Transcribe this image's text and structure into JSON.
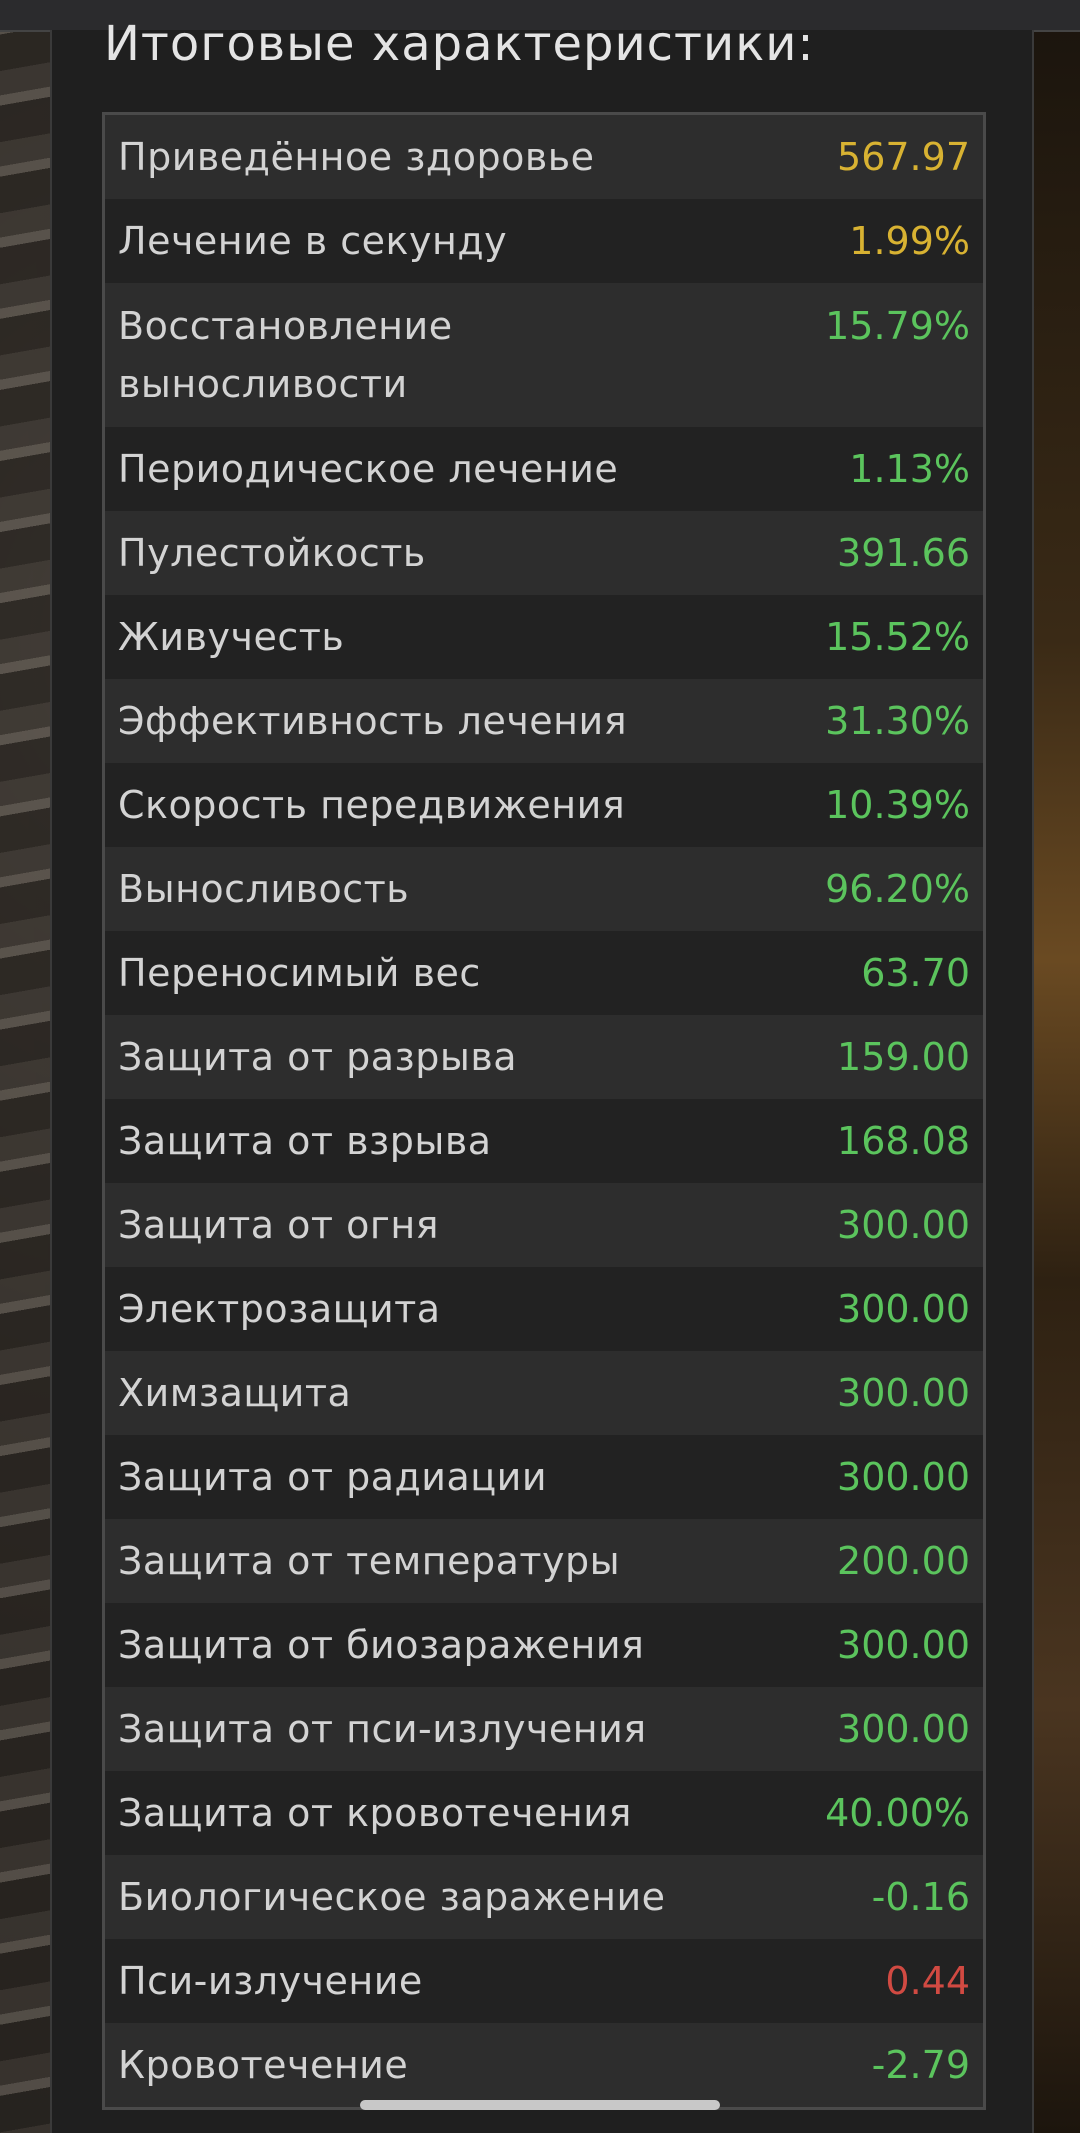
{
  "section": {
    "title": "Итоговые характеристики:"
  },
  "stats": [
    {
      "label": "Приведённое здоровье",
      "value": "567.97",
      "color": "#d8b232"
    },
    {
      "label": "Лечение в секунду",
      "value": "1.99%",
      "color": "#d8b232"
    },
    {
      "label": "Восстановление выносливости",
      "value": "15.79%",
      "color": "#5bc45d"
    },
    {
      "label": "Периодическое лечение",
      "value": "1.13%",
      "color": "#5bc45d"
    },
    {
      "label": "Пулестойкость",
      "value": "391.66",
      "color": "#5bc45d"
    },
    {
      "label": "Живучесть",
      "value": "15.52%",
      "color": "#5bc45d"
    },
    {
      "label": "Эффективность лечения",
      "value": "31.30%",
      "color": "#5bc45d"
    },
    {
      "label": "Скорость передвижения",
      "value": "10.39%",
      "color": "#5bc45d"
    },
    {
      "label": "Выносливость",
      "value": "96.20%",
      "color": "#5bc45d"
    },
    {
      "label": "Переносимый вес",
      "value": "63.70",
      "color": "#5bc45d"
    },
    {
      "label": "Защита от разрыва",
      "value": "159.00",
      "color": "#5bc45d"
    },
    {
      "label": "Защита от взрыва",
      "value": "168.08",
      "color": "#5bc45d"
    },
    {
      "label": "Защита от огня",
      "value": "300.00",
      "color": "#5bc45d"
    },
    {
      "label": "Электрозащита",
      "value": "300.00",
      "color": "#5bc45d"
    },
    {
      "label": "Химзащита",
      "value": "300.00",
      "color": "#5bc45d"
    },
    {
      "label": "Защита от радиации",
      "value": "300.00",
      "color": "#5bc45d"
    },
    {
      "label": "Защита от температуры",
      "value": "200.00",
      "color": "#5bc45d"
    },
    {
      "label": "Защита от биозаражения",
      "value": "300.00",
      "color": "#5bc45d"
    },
    {
      "label": "Защита от пси-излучения",
      "value": "300.00",
      "color": "#5bc45d"
    },
    {
      "label": "Защита от кровотечения",
      "value": "40.00%",
      "color": "#5bc45d"
    },
    {
      "label": "Биологическое заражение",
      "value": "-0.16",
      "color": "#5bc45d"
    },
    {
      "label": "Пси-излучение",
      "value": "0.44",
      "color": "#d14a42"
    },
    {
      "label": "Кровотечение",
      "value": "-2.79",
      "color": "#5bc45d"
    }
  ]
}
